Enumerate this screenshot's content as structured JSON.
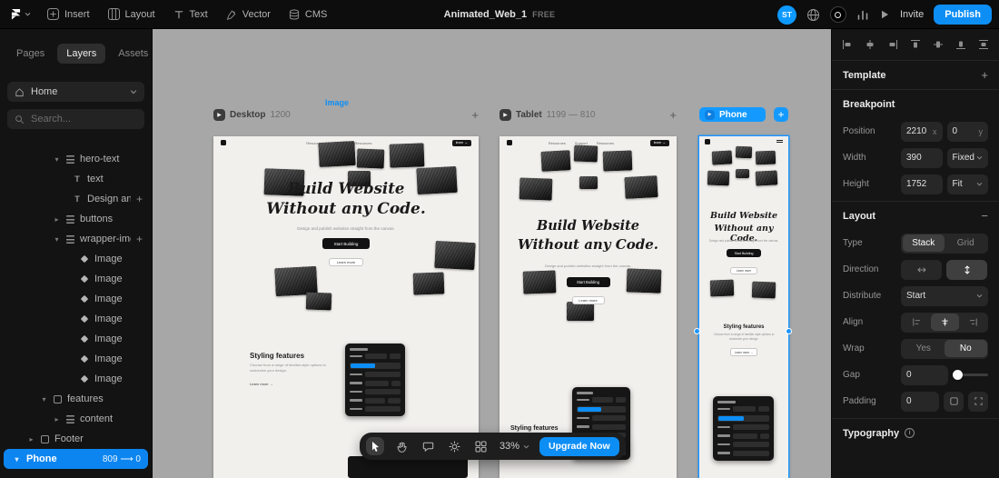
{
  "icons": {
    "plus": "+",
    "minus": "−",
    "caret_right": "▸",
    "caret_down": "▾",
    "play": "▶",
    "text_layer": "T",
    "info": "i"
  },
  "topbar": {
    "menu": [
      "Insert",
      "Layout",
      "Text",
      "Vector",
      "CMS"
    ],
    "title": "Animated_Web_1",
    "badge": "FREE",
    "avatar": "ST",
    "invite": "Invite",
    "publish": "Publish"
  },
  "left_sidebar": {
    "tabs": [
      "Pages",
      "Layers",
      "Assets"
    ],
    "home": "Home",
    "search_placeholder": "Search...",
    "layers": [
      "hero-text",
      "text",
      "Design and p",
      "buttons",
      "wrapper-img",
      "Image",
      "Image",
      "Image",
      "Image",
      "Image",
      "Image",
      "Image",
      "features",
      "content",
      "Footer"
    ],
    "selected_page": {
      "label": "Phone",
      "meta": "809 ⟶ 0"
    }
  },
  "canvas": {
    "selected_label": "Image",
    "frames": [
      {
        "name": "Desktop",
        "size": "1200"
      },
      {
        "name": "Tablet",
        "size": "1199 — 810"
      },
      {
        "name": "Phone",
        "size": ""
      }
    ],
    "site": {
      "nav_links": [
        "Resources",
        "Support",
        "Resources"
      ],
      "nav_cta": "learn →",
      "heading1": "Build Website",
      "heading2": "Without any Code.",
      "subtext": "Design and publish websites straight from the canvas.",
      "cta_primary": "Start Building",
      "cta_secondary": "Learn more",
      "feature_title": "Styling features",
      "feature_text": "Choose from a range of familiar style options to customize your design.",
      "feature_link": "Learn more →"
    },
    "toolbar": {
      "zoom": "33%",
      "upgrade": "Upgrade Now"
    }
  },
  "right_sidebar": {
    "template_title": "Template",
    "breakpoint": {
      "title": "Breakpoint",
      "position_label": "Position",
      "x_value": "2210",
      "x_suffix": "x",
      "y_value": "0",
      "y_suffix": "y",
      "width_label": "Width",
      "width_value": "390",
      "width_mode": "Fixed",
      "height_label": "Height",
      "height_value": "1752",
      "height_mode": "Fit"
    },
    "layout": {
      "title": "Layout",
      "type_label": "Type",
      "type_stack": "Stack",
      "type_grid": "Grid",
      "direction_label": "Direction",
      "distribute_label": "Distribute",
      "distribute_value": "Start",
      "align_label": "Align",
      "wrap_label": "Wrap",
      "wrap_yes": "Yes",
      "wrap_no": "No",
      "gap_label": "Gap",
      "gap_value": "0",
      "padding_label": "Padding",
      "padding_value": "0"
    },
    "typography_title": "Typography"
  },
  "colors": {
    "accent": "#0d8ef5",
    "canvas": "#a7a7a7",
    "selection": "#1e96ff"
  }
}
